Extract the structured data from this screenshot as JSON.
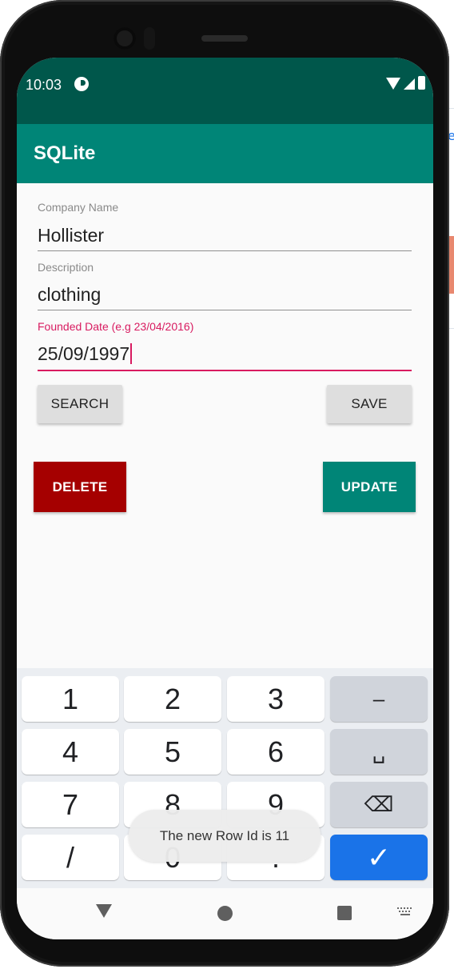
{
  "status_bar": {
    "time": "10:03"
  },
  "app_bar": {
    "title": "SQLite"
  },
  "form": {
    "company_name": {
      "label": "Company Name",
      "value": "Hollister"
    },
    "description": {
      "label": "Description",
      "value": "clothing"
    },
    "founded_date": {
      "label": "Founded Date (e.g 23/04/2016)",
      "value": "25/09/1997"
    }
  },
  "buttons": {
    "search": "SEARCH",
    "save": "SAVE",
    "delete": "DELETE",
    "update": "UPDATE"
  },
  "keyboard": {
    "rows": [
      [
        "1",
        "2",
        "3",
        "–"
      ],
      [
        "4",
        "5",
        "6",
        "␣"
      ],
      [
        "7",
        "8",
        "9",
        "⌫"
      ],
      [
        "/",
        "0",
        ".",
        "✓"
      ]
    ]
  },
  "toast": {
    "message": "The new Row Id is 11"
  },
  "colors": {
    "status_bar": "#00574b",
    "app_bar": "#008577",
    "accent": "#d81b60",
    "delete_button": "#a50000",
    "update_button": "#008577",
    "keyboard_enter": "#1a73e8"
  }
}
